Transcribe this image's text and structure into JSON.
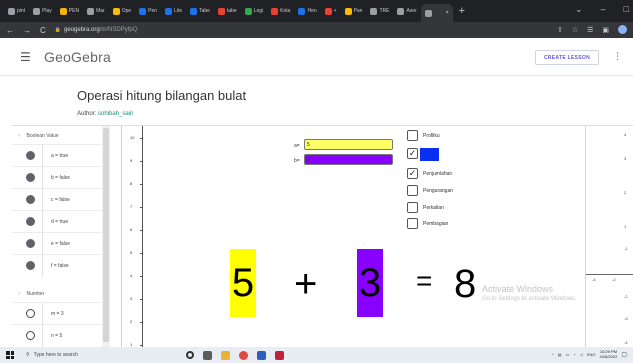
{
  "browser": {
    "tabs": [
      {
        "label": "pint",
        "color": "#9aa0a6"
      },
      {
        "label": "Play",
        "color": "#9aa0a6"
      },
      {
        "label": "PEN",
        "color": "#f4b400"
      },
      {
        "label": "Mar",
        "color": "#9aa0a6"
      },
      {
        "label": "Ope",
        "color": "#fbbc04"
      },
      {
        "label": "Pen",
        "color": "#1a73e8"
      },
      {
        "label": "Lite",
        "color": "#1a73e8"
      },
      {
        "label": "Tabe",
        "color": "#1a73e8"
      },
      {
        "label": "tabe",
        "color": "#ea4335"
      },
      {
        "label": "Logi",
        "color": "#34a853"
      },
      {
        "label": "Kota",
        "color": "#ea4335"
      },
      {
        "label": "Hen",
        "color": "#1a73e8"
      },
      {
        "label": "+",
        "color": "#ea4335"
      },
      {
        "label": "Pan",
        "color": "#fbbc04"
      },
      {
        "label": "TRE",
        "color": "#9aa0a6"
      },
      {
        "label": "Aser",
        "color": "#9aa0a6"
      },
      {
        "label": "",
        "color": "#9aa0a6",
        "active": true
      }
    ],
    "new_tab": "+",
    "window_controls": {
      "minimize": "⌄",
      "min2": "–",
      "restore": "□"
    },
    "url_host": "geogebra.org",
    "url_path": "/m/NSDPyfpQ"
  },
  "header": {
    "logo": "GeoGebra",
    "create_lesson": "CREATE LESSON",
    "menu_icon": "hamburger-icon",
    "more_icon": "more-vert-icon"
  },
  "page": {
    "title": "Operasi hitung bilangan bulat",
    "author_label": "Author:",
    "author_name": "sohibah_sain"
  },
  "algebra": {
    "group1": "Boolean Value",
    "rows_bool": [
      "a = true",
      "b = false",
      "c = false",
      "d = true",
      "e = false",
      "f = false"
    ],
    "group2": "Number",
    "rows_num": [
      "m = 3",
      "n = 5"
    ]
  },
  "graphics": {
    "y_ticks": [
      "10",
      "9",
      "8",
      "7",
      "6",
      "5",
      "4",
      "3",
      "2",
      "1"
    ],
    "input_a_label": "a=",
    "input_a_value": "5",
    "input_b_label": "b=",
    "input_b_value": "3",
    "checkboxes": [
      {
        "label": "Profilku",
        "checked": false
      },
      {
        "label": "",
        "checked": true
      },
      {
        "label": "Penjumlahan",
        "checked": true
      },
      {
        "label": "Pengurangan",
        "checked": false
      },
      {
        "label": "Perkalian",
        "checked": false
      },
      {
        "label": "Pembagian",
        "checked": false
      }
    ],
    "equation": {
      "a": "5",
      "op": "+",
      "b": "3",
      "eq": "=",
      "result": "8"
    },
    "colors": {
      "a_block": "#ffff00",
      "b_block": "#8800ff",
      "input_b_fill": "#8800ff",
      "input_a_fill": "#ffff66",
      "blue_box": "#0a2ff0"
    }
  },
  "graphics2": {
    "y_ticks": [
      "4",
      "3",
      "2",
      "1",
      "-1",
      "-2",
      "-3",
      "-4"
    ],
    "x_ticks": [
      "-4",
      "-2"
    ]
  },
  "watermark": {
    "line1": "Activate Windows",
    "line2": "Go to Settings to activate Windows."
  },
  "taskbar": {
    "search_placeholder": "Type here to search",
    "lang": "ENG",
    "time": "10:29 PM",
    "date": "4/26/2022"
  }
}
